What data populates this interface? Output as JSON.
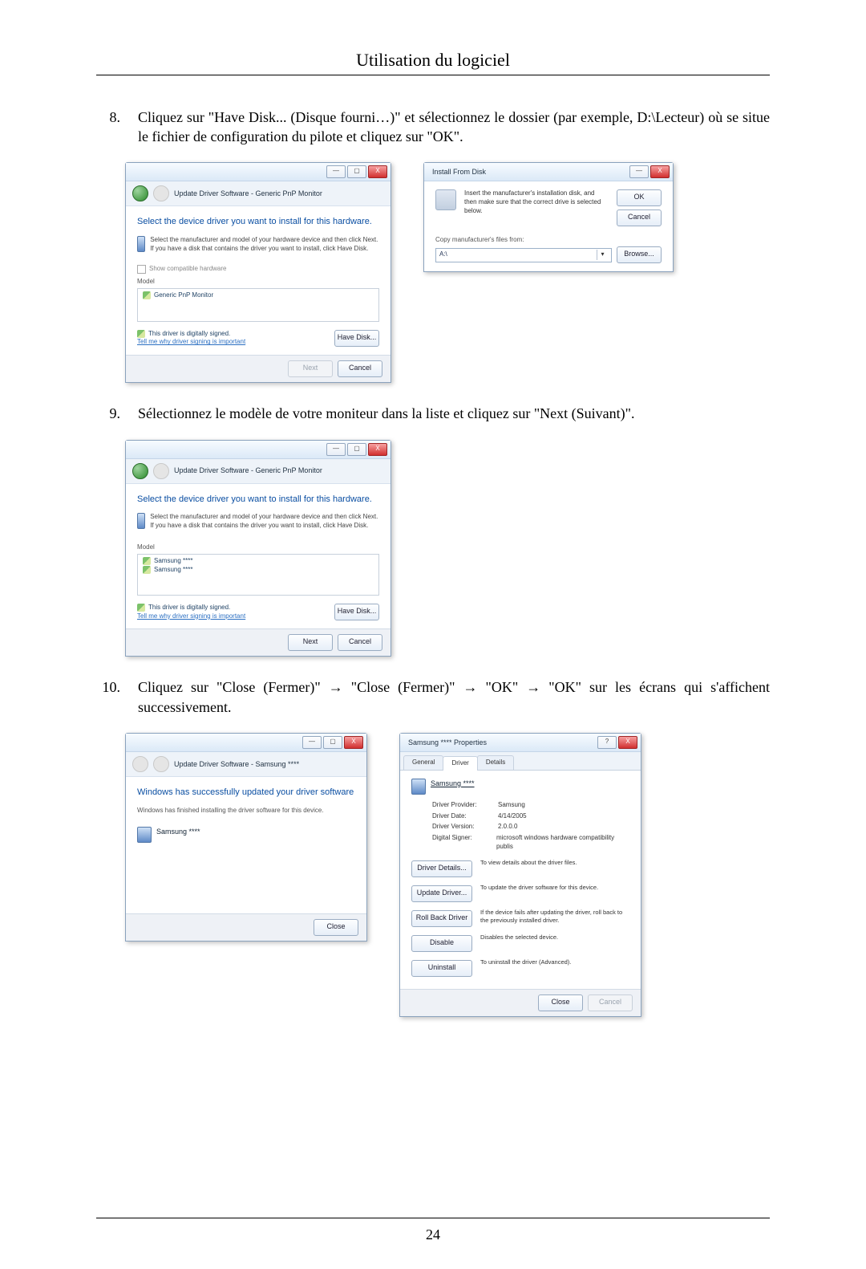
{
  "header": {
    "title": "Utilisation du logiciel"
  },
  "items": [
    {
      "n": "8.",
      "text": "Cliquez sur \"Have Disk... (Disque fourni…)\" et sélectionnez le dossier (par exemple, D:\\Lecteur) où se situe le fichier de configuration du pilote et cliquez sur \"OK\"."
    },
    {
      "n": "9.",
      "text": "Sélectionnez le modèle de votre moniteur dans la liste et cliquez sur \"Next (Suivant)\"."
    },
    {
      "n": "10.",
      "text": "Cliquez sur \"Close (Fermer)\" → \"Close (Fermer)\" → \"OK\" → \"OK\" sur les écrans qui s'affichent successivement."
    }
  ],
  "win": {
    "min": "—",
    "max": "▢",
    "close": "X"
  },
  "updateDriver": {
    "title": "Update Driver Software - Generic PnP Monitor",
    "heading": "Select the device driver you want to install for this hardware.",
    "info": "Select the manufacturer and model of your hardware device and then click Next. If you have a disk that contains the driver you want to install, click Have Disk.",
    "showCompat": "Show compatible hardware",
    "modelLabel": "Model",
    "model1": "Generic PnP Monitor",
    "signed": "This driver is digitally signed.",
    "signedLink": "Tell me why driver signing is important",
    "haveDisk": "Have Disk...",
    "next": "Next",
    "cancel": "Cancel"
  },
  "installFrom": {
    "title": "Install From Disk",
    "msg": "Insert the manufacturer's installation disk, and then make sure that the correct drive is selected below.",
    "ok": "OK",
    "cancel": "Cancel",
    "copyLabel": "Copy manufacturer's files from:",
    "path": "A:\\",
    "browse": "Browse..."
  },
  "selectModel": {
    "title": "Update Driver Software - Generic PnP Monitor",
    "model1": "Samsung ****",
    "model2": "Samsung ****",
    "next": "Next",
    "cancel": "Cancel"
  },
  "success": {
    "title": "Update Driver Software - Samsung ****",
    "msg": "Windows has successfully updated your driver software",
    "sub": "Windows has finished installing the driver software for this device.",
    "device": "Samsung ****",
    "close": "Close"
  },
  "props": {
    "title": "Samsung **** Properties",
    "tabGeneral": "General",
    "tabDriver": "Driver",
    "tabDetails": "Details",
    "device": "Samsung ****",
    "provK": "Driver Provider:",
    "provV": "Samsung",
    "dateK": "Driver Date:",
    "dateV": "4/14/2005",
    "verK": "Driver Version:",
    "verV": "2.0.0.0",
    "signK": "Digital Signer:",
    "signV": "microsoft windows hardware compatibility publis",
    "bDetails": "Driver Details...",
    "dDetails": "To view details about the driver files.",
    "bUpdate": "Update Driver...",
    "dUpdate": "To update the driver software for this device.",
    "bRoll": "Roll Back Driver",
    "dRoll": "If the device fails after updating the driver, roll back to the previously installed driver.",
    "bDisable": "Disable",
    "dDisable": "Disables the selected device.",
    "bUninst": "Uninstall",
    "dUninst": "To uninstall the driver (Advanced).",
    "close": "Close",
    "cancel": "Cancel"
  },
  "page": {
    "number": "24"
  }
}
